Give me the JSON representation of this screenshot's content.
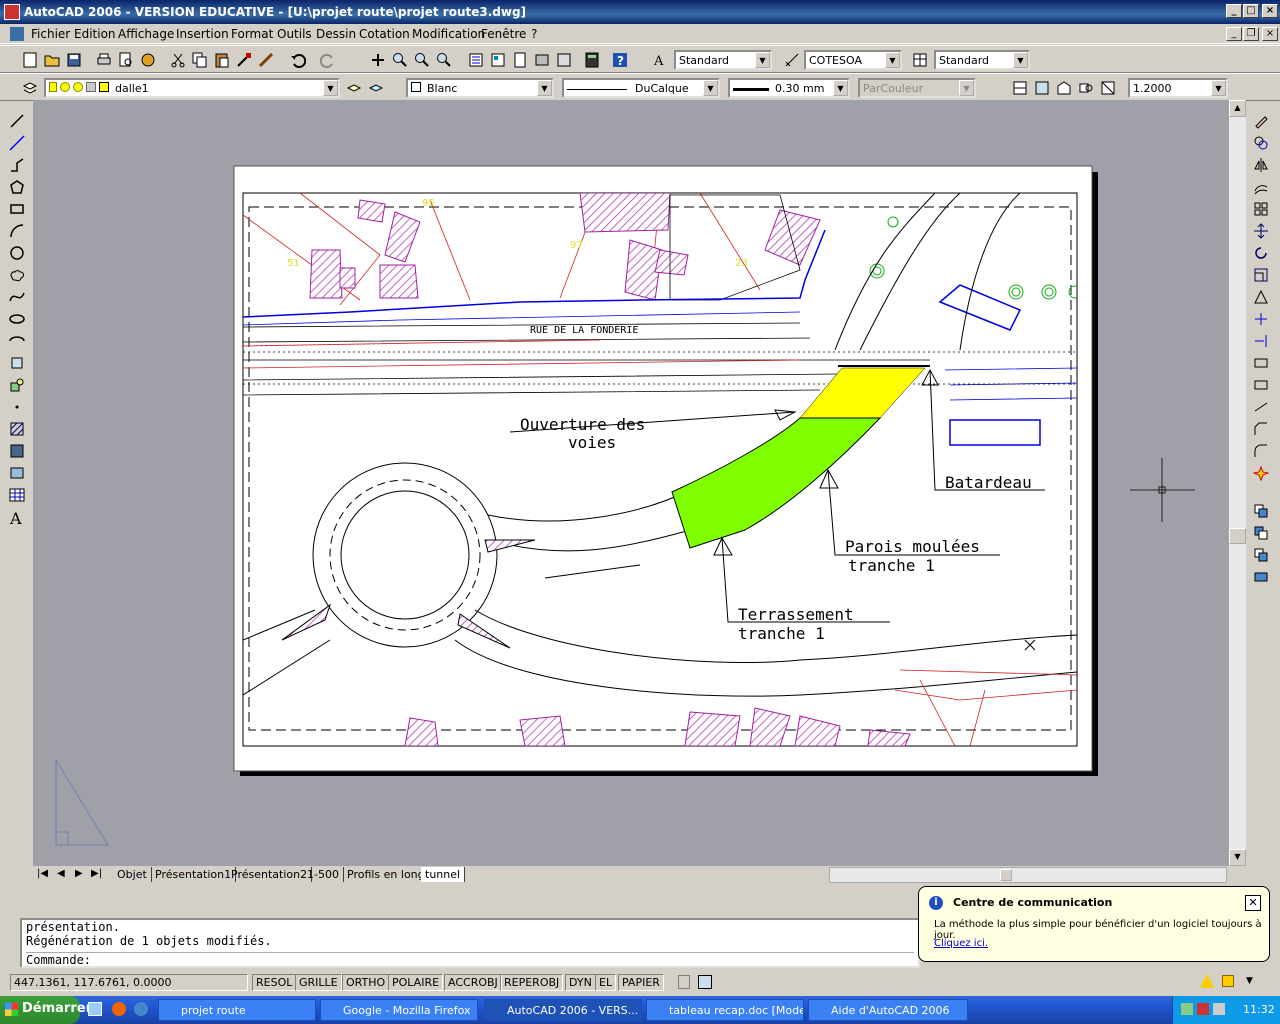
{
  "window": {
    "title": "AutoCAD 2006 - VERSION EDUCATIVE - [U:\\projet route\\projet route3.dwg]"
  },
  "menu": [
    "Fichier",
    "Edition",
    "Affichage",
    "Insertion",
    "Format",
    "Outils",
    "Dessin",
    "Cotation",
    "Modification",
    "Fenêtre",
    "?"
  ],
  "toolbar": {
    "text_style": "Standard",
    "dim_style": "COTESOA",
    "table_style": "Standard",
    "layer": "dalle1",
    "color": "Blanc",
    "linetype": "DuCalque",
    "lineweight": "0.30 mm",
    "plotstyle": "ParCouleur",
    "viewport_scale": "1.2000"
  },
  "drawing": {
    "street": "RUE DE LA FONDERIE",
    "labels": {
      "ouverture_1": "Ouverture des",
      "ouverture_2": "voies",
      "batardeau": "Batardeau",
      "parois_1": "Parois moulées",
      "parois_2": "tranche 1",
      "terr_1": "Terrassement",
      "terr_2": "tranche 1"
    },
    "parcels": [
      "51",
      "97",
      "23",
      "95"
    ],
    "yellow": "#ffff00",
    "green": "#80ff00"
  },
  "tabs": [
    "Objet",
    "Présentation1",
    "Présentation2",
    "1-500",
    "Profils en long",
    "tunnel"
  ],
  "command": {
    "line1": "présentation.",
    "line2": "Régénération de 1 objets modifiés.",
    "prompt": "Commande:"
  },
  "status": {
    "coords": "447.1361, 117.6761, 0.0000",
    "buttons": [
      "RESOL",
      "GRILLE",
      "ORTHO",
      "POLAIRE",
      "ACCROBJ",
      "REPEROBJ",
      "DYN",
      "EL",
      "PAPIER"
    ]
  },
  "balloon": {
    "title": "Centre de communication",
    "text": "La méthode la plus simple pour bénéficier d'un logiciel toujours à jour.",
    "link": "Cliquez ici."
  },
  "taskbar": {
    "start": "Démarrer",
    "items": [
      "projet route",
      "Google - Mozilla Firefox",
      "AutoCAD 2006 - VERS...",
      "tableau recap.doc [Mode...",
      "Aide d'AutoCAD 2006"
    ],
    "clock": "11:32"
  }
}
